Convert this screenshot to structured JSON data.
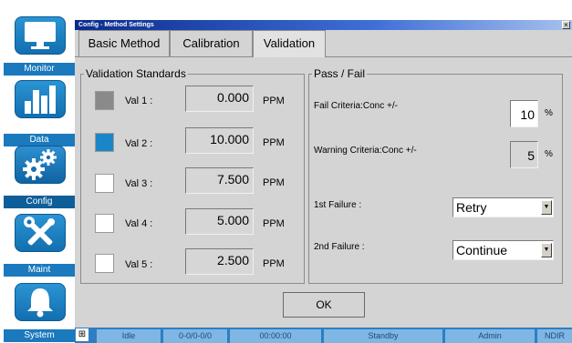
{
  "nav": {
    "items": [
      {
        "label": "Monitor",
        "icon": "monitor-icon"
      },
      {
        "label": "Data",
        "icon": "bar-chart-icon"
      },
      {
        "label": "Config",
        "icon": "gears-icon"
      },
      {
        "label": "Maint",
        "icon": "tools-icon"
      },
      {
        "label": "System",
        "icon": "bell-icon"
      }
    ],
    "active": "Config"
  },
  "window": {
    "title": "Config - Method Settings",
    "close_label": "×"
  },
  "tabs": [
    {
      "label": "Basic Method",
      "selected": false
    },
    {
      "label": "Calibration",
      "selected": false
    },
    {
      "label": "Validation",
      "selected": true
    }
  ],
  "validation": {
    "title": "Validation Standards",
    "rows": [
      {
        "label": "Val 1 :",
        "value": "0.000",
        "unit": "PPM",
        "swatch_color": "#8a8a8a"
      },
      {
        "label": "Val 2 :",
        "value": "10.000",
        "unit": "PPM",
        "swatch_color": "#1a86c8"
      },
      {
        "label": "Val 3 :",
        "value": "7.500",
        "unit": "PPM",
        "swatch_color": "#ffffff"
      },
      {
        "label": "Val 4 :",
        "value": "5.000",
        "unit": "PPM",
        "swatch_color": "#ffffff"
      },
      {
        "label": "Val 5 :",
        "value": "2.500",
        "unit": "PPM",
        "swatch_color": "#ffffff"
      }
    ]
  },
  "passfail": {
    "title": "Pass / Fail",
    "fail_label": "Fail Criteria:Conc +/-",
    "fail_value": "10",
    "fail_unit": "%",
    "warn_label": "Warning Criteria:Conc +/-",
    "warn_value": "5",
    "warn_unit": "%",
    "first_failure_label": "1st Failure :",
    "first_failure_value": "Retry",
    "second_failure_label": "2nd Failure :",
    "second_failure_value": "Continue"
  },
  "ok_label": "OK",
  "status": {
    "state": "Idle",
    "code": "0-0/0-0/0",
    "time": "00:00:00",
    "mode": "Standby",
    "user": "Admin",
    "sensor": "NDIR"
  },
  "colors": {
    "nav_blue": "#1b79bd",
    "status_blue": "#2e7ec1",
    "title_blue": "#0a2b8c"
  }
}
